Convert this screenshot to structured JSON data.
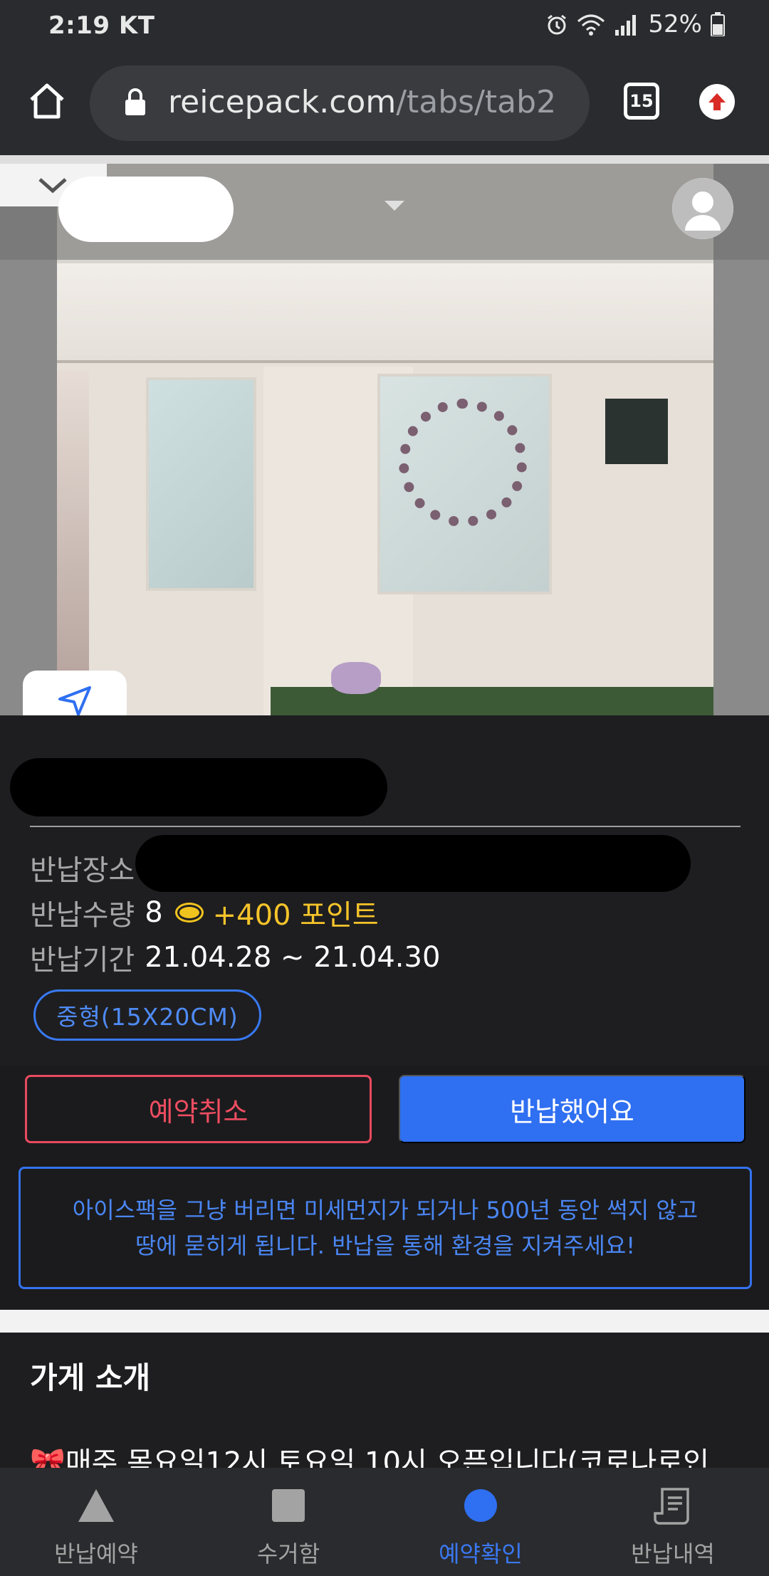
{
  "status_bar": {
    "time": "2:19",
    "carrier": "KT",
    "battery": "52%"
  },
  "browser": {
    "url_domain": "reicepack.com",
    "url_path": "/tabs/tab2",
    "tab_count": "15"
  },
  "reservation": {
    "place_label": "반납장소",
    "qty_label": "반납수량",
    "qty_value": "8",
    "points": "+400 포인트",
    "period_label": "반납기간",
    "period_value": "21.04.28 ~ 21.04.30",
    "size_tag": "중형(15X20CM)"
  },
  "actions": {
    "cancel_label": "예약취소",
    "returned_label": "반납했어요"
  },
  "notice": {
    "line1": "아이스팩을 그냥 버리면 미세먼지가 되거나 500년 동안 썩지 않고",
    "line2": "땅에 묻히게 됩니다. 반납을 통해 환경을 지켜주세요!"
  },
  "store_intro": {
    "title": "가게 소개",
    "emoji": "🎀",
    "text": "매주 목요일12시,토요일 10시 오픈입니다(코로나로인"
  },
  "bottom_nav": {
    "items": [
      {
        "label": "반납예약",
        "icon": "triangle-icon",
        "active": false
      },
      {
        "label": "수거함",
        "icon": "square-icon",
        "active": false
      },
      {
        "label": "예약확인",
        "icon": "circle-icon",
        "active": true
      },
      {
        "label": "반납내역",
        "icon": "receipt-icon",
        "active": false
      }
    ]
  },
  "colors": {
    "accent_blue": "#2f6ff1",
    "cancel_red": "#e84a5f",
    "points_yellow": "#f6c42a",
    "background": "#1e1e20"
  }
}
